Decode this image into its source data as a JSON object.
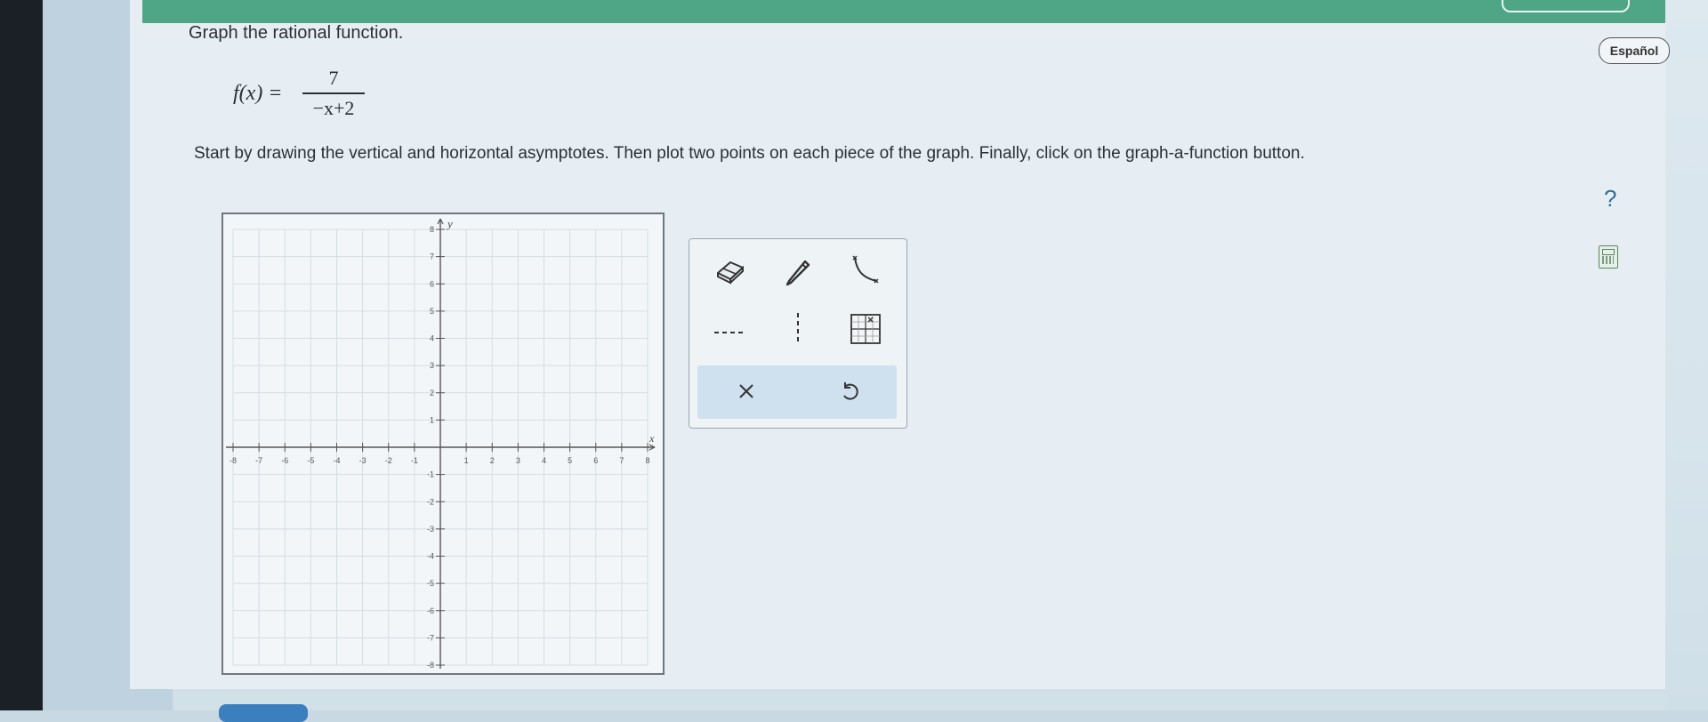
{
  "prompt": "Graph the rational function.",
  "formula": {
    "lhs": "f(x) =",
    "numerator": "7",
    "denominator": "−x+2"
  },
  "instruction": "Start by drawing the vertical and horizontal asymptotes. Then plot two points on each piece of the graph. Finally, click on the graph-a-function button.",
  "language_button": "Español",
  "help_icon": "?",
  "graph": {
    "x_label": "x",
    "y_label": "y",
    "x_ticks": [
      "-8",
      "-7",
      "-6",
      "-5",
      "-4",
      "-3",
      "-2",
      "-1",
      "1",
      "2",
      "3",
      "4",
      "5",
      "6",
      "7",
      "8"
    ],
    "y_ticks": [
      "8",
      "7",
      "6",
      "5",
      "4",
      "3",
      "2",
      "1",
      "-1",
      "-2",
      "-3",
      "-4",
      "-5",
      "-6",
      "-7",
      "-8"
    ],
    "x_range": [
      -8,
      8
    ],
    "y_range": [
      -8,
      8
    ]
  },
  "tools": [
    {
      "name": "eraser-tool-icon"
    },
    {
      "name": "pencil-tool-icon"
    },
    {
      "name": "graph-a-function-icon"
    },
    {
      "name": "horizontal-asymptote-icon"
    },
    {
      "name": "vertical-asymptote-icon"
    },
    {
      "name": "asymptote-grid-icon"
    },
    {
      "name": "clear-icon"
    },
    {
      "name": "undo-icon"
    }
  ]
}
